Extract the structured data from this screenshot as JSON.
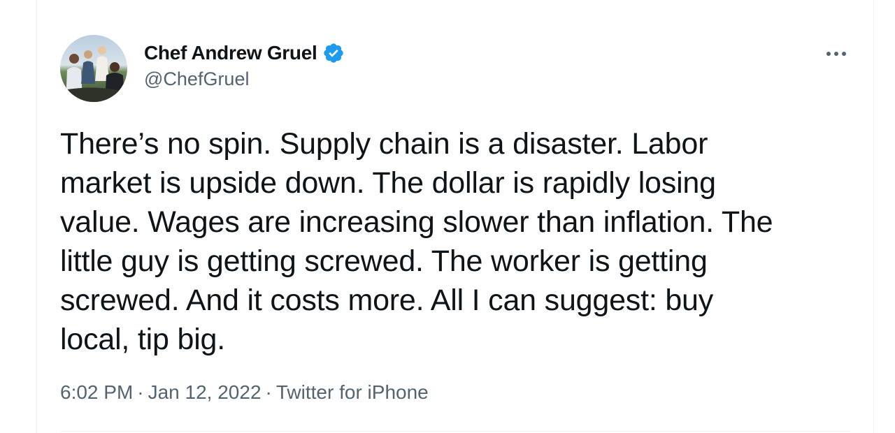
{
  "tweet": {
    "author": {
      "display_name": "Chef Andrew Gruel",
      "handle": "@ChefGruel",
      "verified": true,
      "verified_icon": "verified-badge-icon"
    },
    "more_icon": "more-horizontal-icon",
    "text": "There’s no spin. Supply chain is a disaster. Labor\nmarket is upside down. The dollar is rapidly losing\nvalue. Wages are increasing slower than inflation. The\nlittle guy is getting screwed. The worker is getting\nscrewed. And it costs more. All I can suggest: buy\nlocal, tip big.",
    "timestamp_time": "6:02 PM",
    "timestamp_date": "Jan 12, 2022",
    "separator": "·",
    "source": "Twitter for iPhone"
  },
  "colors": {
    "text_primary": "#0f1419",
    "text_secondary": "#536471",
    "verified_blue": "#1d9bf0",
    "border": "#eff3f4"
  }
}
